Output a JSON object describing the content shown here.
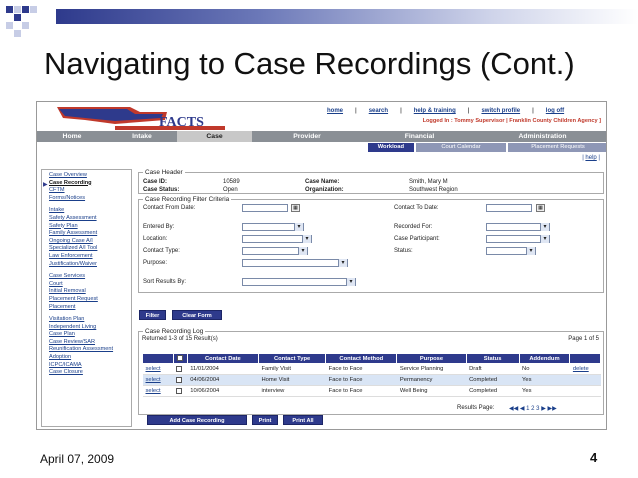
{
  "slide": {
    "title": "Navigating to Case Recordings (Cont.)",
    "date": "April 07, 2009",
    "page_number": "4"
  },
  "app": {
    "logo_text": "FACTS",
    "top_links": [
      "home",
      "search",
      "help & training",
      "switch profile",
      "log off"
    ],
    "logged_in": "Logged In : Tommy Supervisor | Franklin County Children Agency ]",
    "nav_tabs": [
      "Home",
      "Intake",
      "Case",
      "Provider",
      "Financial",
      "Administration"
    ],
    "sub_tabs": [
      "Workload",
      "Court Calendar",
      "Placement Requests"
    ],
    "help_link": "help"
  },
  "sidebar": {
    "groups": [
      [
        "Case Overview",
        "Case Recording",
        "CFTM",
        "Forms/Notices"
      ],
      [
        "Intake",
        "Safety Assessment",
        "Safety Plan",
        "Family Assessment",
        "Ongoing Case A/I",
        "Specialized A/I Tool",
        "Law Enforcement",
        "Justification/Waiver"
      ],
      [
        "Case Services",
        "Court",
        "Initial Removal",
        "Placement Request",
        "Placement"
      ],
      [
        "Visitation Plan",
        "Independent Living",
        "Case Plan",
        "Case Review/SAR",
        "Reunification Assessment",
        "Adoption",
        "ICPC/ICAMA",
        "Case Closure"
      ]
    ]
  },
  "case_header": {
    "legend": "Case Header",
    "case_id_label": "Case ID:",
    "case_id": "10589",
    "case_status_label": "Case Status:",
    "case_status": "Open",
    "case_name_label": "Case Name:",
    "case_name": "Smith, Mary M",
    "org_label": "Organization:",
    "org": "Southwest Region"
  },
  "filter": {
    "legend": "Case Recording Filter Criteria",
    "contact_from": "Contact From Date:",
    "contact_to": "Contact To Date:",
    "entered_by": "Entered By:",
    "recorded_for": "Recorded For:",
    "location": "Location:",
    "case_participant": "Case Participant:",
    "contact_type": "Contact Type:",
    "status": "Status:",
    "purpose": "Purpose:",
    "sort_by": "Sort Results By:",
    "filter_btn": "Filter",
    "clear_btn": "Clear Form"
  },
  "log": {
    "legend": "Case Recording Log",
    "returned": "Returned 1-3 of 15 Result(s)",
    "page": "Page 1 of 5",
    "columns": [
      "",
      "",
      "Contact Date",
      "Contact Type",
      "Contact Method",
      "Purpose",
      "Status",
      "Addendum",
      ""
    ],
    "rows": [
      [
        "select",
        "11/01/2004",
        "Family Visit",
        "Face to Face",
        "Service Planning",
        "Draft",
        "No",
        "delete"
      ],
      [
        "select",
        "04/06/2004",
        "Home Visit",
        "Face to Face",
        "Permanency",
        "Completed",
        "Yes",
        ""
      ],
      [
        "select",
        "10/06/2004",
        "interview",
        "Face to Face",
        "Well Being",
        "Completed",
        "Yes",
        ""
      ]
    ],
    "results_page": "Results Page:",
    "pager": "◀◀ ◀ 1 2 3 ▶ ▶▶",
    "add_btn": "Add Case Recording",
    "print_btn": "Print",
    "printall_btn": "Print All"
  }
}
